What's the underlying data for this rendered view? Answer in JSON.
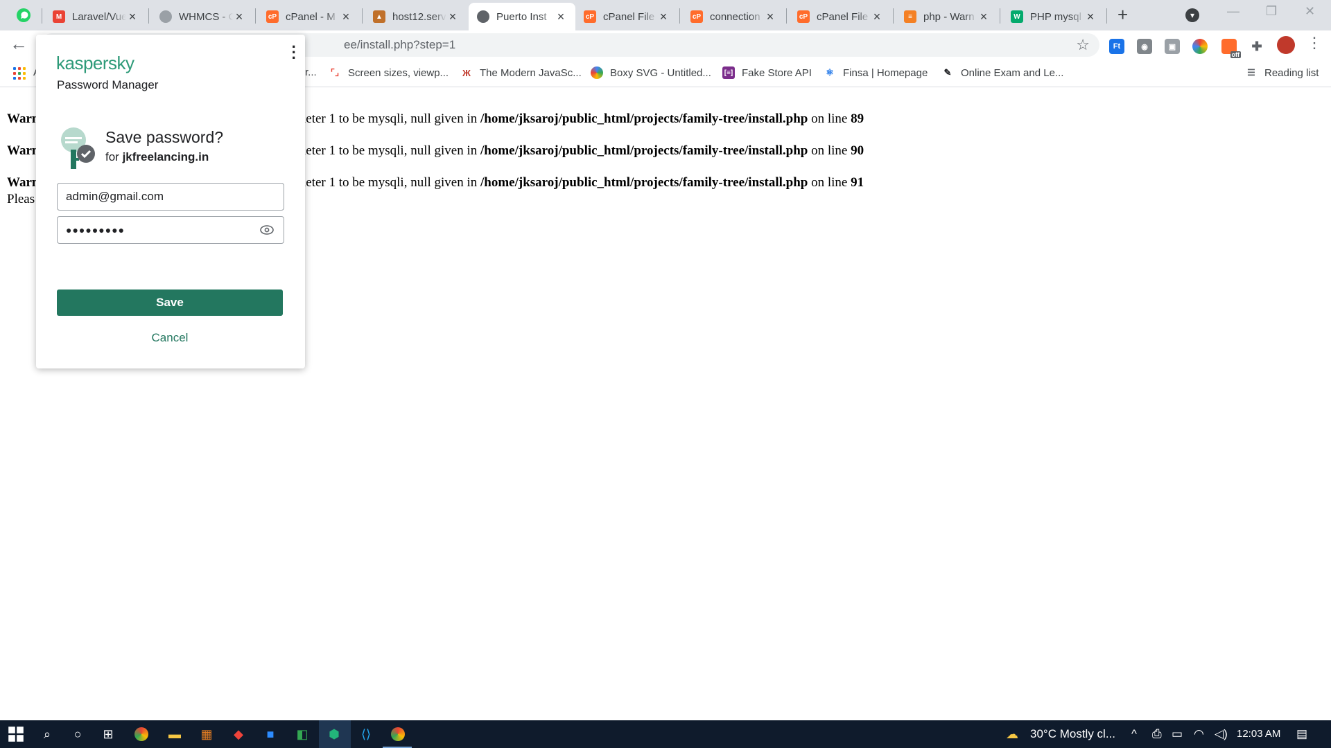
{
  "browser": {
    "tabs": [
      {
        "title": "",
        "favicon": "whatsapp-icon",
        "color": "#25d366"
      },
      {
        "title": "Laravel/Vue",
        "favicon": "gmail-icon",
        "color": "#ea4335"
      },
      {
        "title": "WHMCS - C",
        "favicon": "globe-icon",
        "color": "#9aa0a6"
      },
      {
        "title": "cPanel - M",
        "favicon": "cpanel-icon",
        "color": "#ff6c2c"
      },
      {
        "title": "host12.serv",
        "favicon": "host-icon",
        "color": "#c0702a"
      },
      {
        "title": "Puerto Inst",
        "favicon": "globe-icon",
        "color": "#5f6368",
        "active": true
      },
      {
        "title": "cPanel File",
        "favicon": "cpanel-icon",
        "color": "#ff6c2c"
      },
      {
        "title": "connection",
        "favicon": "cpanel-icon",
        "color": "#ff6c2c"
      },
      {
        "title": "cPanel File",
        "favicon": "cpanel-icon",
        "color": "#ff6c2c"
      },
      {
        "title": "php - Warn",
        "favicon": "stackoverflow-icon",
        "color": "#f48024"
      },
      {
        "title": "PHP mysql",
        "favicon": "w3schools-icon",
        "color": "#04aa6d"
      }
    ],
    "new_tab": "+",
    "url": "ee/install.php?step=1",
    "reading_list": "Reading list",
    "extension_badge": "off",
    "bookmarks": [
      {
        "label": "r...",
        "icon": "page-icon"
      },
      {
        "label": "Screen sizes, viewp...",
        "icon": "resize-icon"
      },
      {
        "label": "The Modern JavaSc...",
        "icon": "javascript-info-icon"
      },
      {
        "label": "Boxy SVG - Untitled...",
        "icon": "boxy-svg-icon"
      },
      {
        "label": "Fake Store API",
        "icon": "fake-store-icon"
      },
      {
        "label": "Finsa | Homepage",
        "icon": "react-icon"
      },
      {
        "label": "Online Exam and Le...",
        "icon": "exam-icon"
      }
    ],
    "apps_truncated": "A"
  },
  "page": {
    "warnings": [
      {
        "prefix": "Warn",
        "text": "ieter 1 to be mysqli, null given in ",
        "path": "/home/jksaroj/public_html/projects/family-tree/install.php",
        "mid": " on line ",
        "line": "89"
      },
      {
        "prefix": "Warn",
        "text": "ieter 1 to be mysqli, null given in ",
        "path": "/home/jksaroj/public_html/projects/family-tree/install.php",
        "mid": " on line ",
        "line": "90"
      },
      {
        "prefix": "Warn",
        "text": "ieter 1 to be mysqli, null given in ",
        "path": "/home/jksaroj/public_html/projects/family-tree/install.php",
        "mid": " on line ",
        "line": "91"
      }
    ],
    "please": "Pleas"
  },
  "popup": {
    "brand": "kaspersky",
    "product": "Password Manager",
    "title": "Save password?",
    "for_prefix": "for ",
    "site": "jkfreelancing.in",
    "email": "admin@gmail.com",
    "password_mask": "●●●●●●●●●",
    "save_label": "Save",
    "cancel_label": "Cancel",
    "accent": "#23775f"
  },
  "taskbar": {
    "weather": "30°C  Mostly cl...",
    "time": "12:03 AM"
  }
}
